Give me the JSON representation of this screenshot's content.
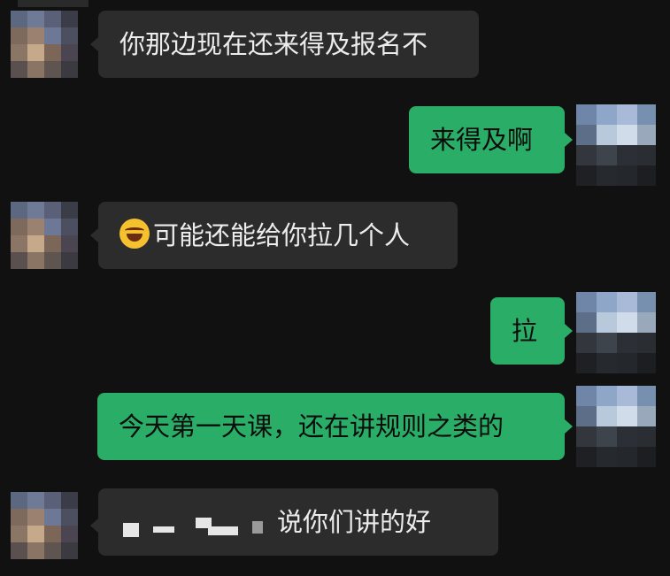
{
  "chat": {
    "messages": [
      {
        "sender": "them",
        "text": "你那边现在还来得及报名不"
      },
      {
        "sender": "me",
        "text": "来得及啊"
      },
      {
        "sender": "them",
        "emoji": "face-with-tears-of-joy-icon",
        "text": "可能还能给你拉几个人"
      },
      {
        "sender": "me",
        "text": "拉"
      },
      {
        "sender": "me",
        "text": "今天第一天课，还在讲规则之类的"
      },
      {
        "sender": "them",
        "redacted_prefix": "(redacted)",
        "text": "说你们讲的好"
      }
    ]
  },
  "colors": {
    "background": "#111111",
    "incoming_bubble": "#2c2c2c",
    "outgoing_bubble": "#2aae67"
  }
}
